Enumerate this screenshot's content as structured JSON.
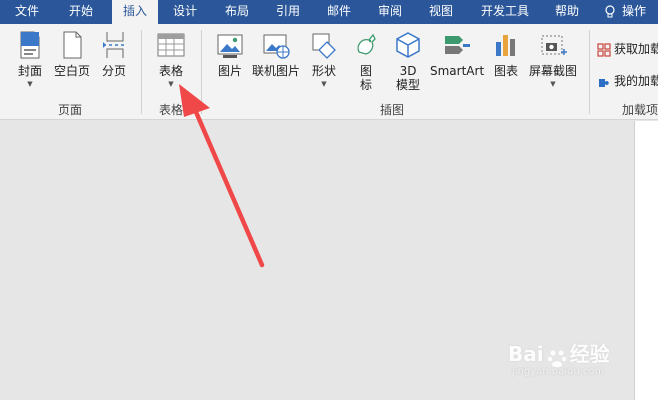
{
  "tabs": [
    {
      "label": "文件",
      "active": false
    },
    {
      "label": "开始",
      "active": false
    },
    {
      "label": "插入",
      "active": true
    },
    {
      "label": "设计",
      "active": false
    },
    {
      "label": "布局",
      "active": false
    },
    {
      "label": "引用",
      "active": false
    },
    {
      "label": "邮件",
      "active": false
    },
    {
      "label": "审阅",
      "active": false
    },
    {
      "label": "视图",
      "active": false
    },
    {
      "label": "开发工具",
      "active": false
    },
    {
      "label": "帮助",
      "active": false
    }
  ],
  "tell_me": {
    "label": "操作",
    "icon": "lightbulb-icon"
  },
  "groups": {
    "pages": {
      "label": "页面",
      "buttons": [
        {
          "label": "封面",
          "icon": "cover-page-icon",
          "dropdown": true
        },
        {
          "label": "空白页",
          "icon": "blank-page-icon",
          "dropdown": false
        },
        {
          "label": "分页",
          "icon": "page-break-icon",
          "dropdown": false
        }
      ]
    },
    "tables": {
      "label": "表格",
      "buttons": [
        {
          "label": "表格",
          "icon": "table-icon",
          "dropdown": true
        }
      ]
    },
    "illustrations": {
      "label": "插图",
      "buttons": [
        {
          "label": "图片",
          "icon": "picture-icon"
        },
        {
          "label": "联机图片",
          "icon": "online-picture-icon"
        },
        {
          "label": "形状",
          "icon": "shapes-icon",
          "dropdown": true
        },
        {
          "label_line1": "图",
          "label_line2": "标",
          "icon": "icons-icon"
        },
        {
          "label_line1": "3D",
          "label_line2": "模型",
          "icon": "3d-model-icon"
        },
        {
          "label": "SmartArt",
          "icon": "smartart-icon"
        },
        {
          "label": "图表",
          "icon": "chart-icon"
        },
        {
          "label": "屏幕截图",
          "icon": "screenshot-icon",
          "dropdown": true
        }
      ]
    },
    "addins": {
      "label": "加载项",
      "buttons": [
        {
          "label": "获取加载项",
          "icon": "get-addins-icon"
        },
        {
          "label": "我的加载项",
          "icon": "my-addins-icon"
        }
      ]
    }
  },
  "watermark": {
    "brand": "Bai",
    "brand2": "经验",
    "sub": "jingyan.baidu.com"
  },
  "colors": {
    "tab_bar": "#2b579a",
    "ribbon": "#f3f3f3",
    "canvas": "#e6e6e6",
    "arrow": "#f04848"
  }
}
